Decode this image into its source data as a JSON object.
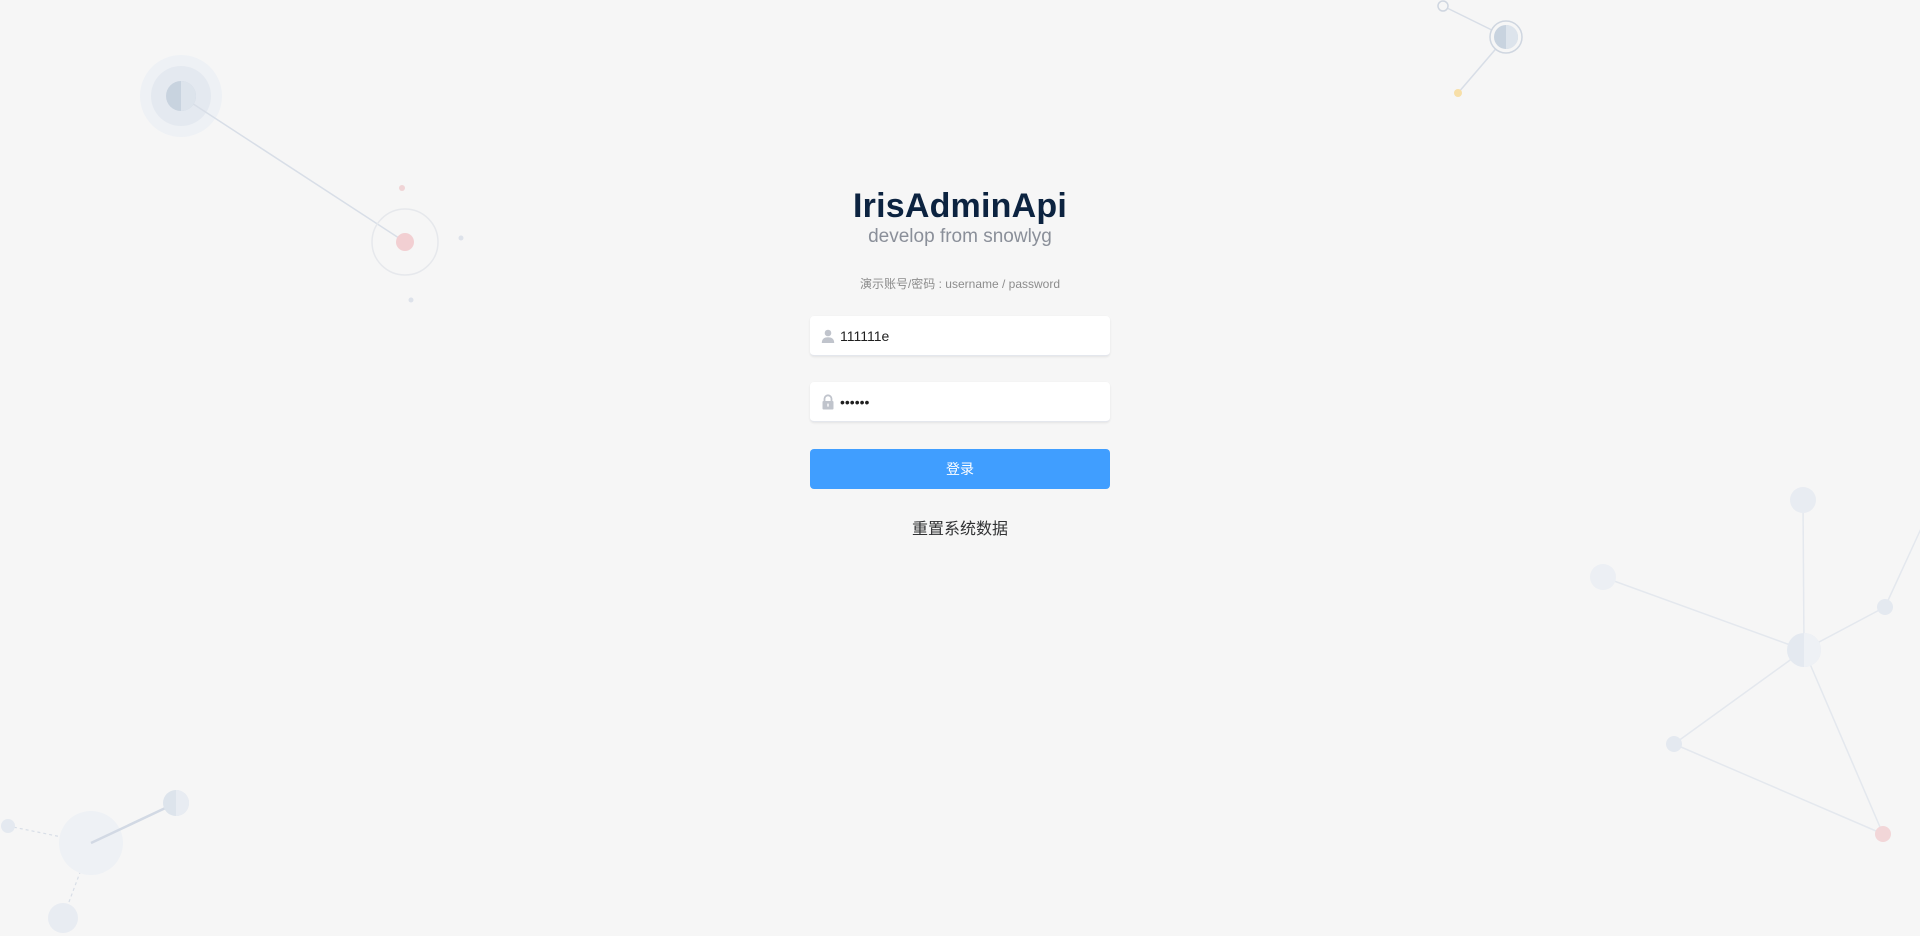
{
  "app": {
    "title": "IrisAdminApi",
    "subtitle": "develop from snowlyg"
  },
  "hint": {
    "demo_account": "演示账号/密码 : username / password"
  },
  "form": {
    "username_value": "111111e",
    "username_icon": "user-icon",
    "password_value": "••••••",
    "password_icon": "lock-icon",
    "login_label": "登录",
    "reset_label": "重置系统数据"
  },
  "colors": {
    "background": "#f6f6f6",
    "title": "#0c2340",
    "primary_button": "#409eff"
  }
}
